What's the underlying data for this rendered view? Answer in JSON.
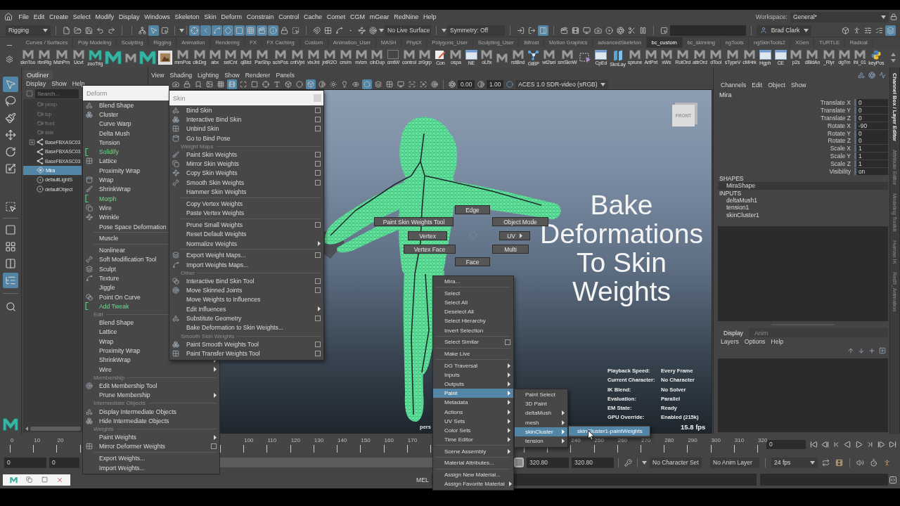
{
  "menu_bar": {
    "items": [
      "File",
      "Edit",
      "Create",
      "Select",
      "Modify",
      "Display",
      "Windows",
      "Skeleton",
      "Skin",
      "Deform",
      "Constrain",
      "Control",
      "Cache",
      "Comet",
      "CGM",
      "mGear",
      "RedNine",
      "Help"
    ],
    "workspace_label": "Workspace:",
    "workspace": "General*"
  },
  "toolbar": {
    "menu_set": "Rigging",
    "select_modes": [
      {
        "selected": false
      },
      {
        "selected": true
      },
      {
        "selected": false
      }
    ],
    "masks": [
      {
        "on": true
      },
      {
        "on": true
      },
      {
        "on": true
      },
      {
        "on": true
      },
      {
        "on": true
      },
      {
        "on": true
      },
      {
        "on": true
      },
      {
        "on": true
      }
    ],
    "live_surface": "No Live Surface",
    "symmetry": "Symmetry: Off",
    "tool_toggles": [
      {
        "selected": false
      },
      {
        "selected": false
      },
      {
        "selected": true
      }
    ],
    "user": "Brad Clark",
    "panel_toggles": [
      {
        "selected": false
      },
      {
        "selected": false
      },
      {
        "selected": false
      },
      {
        "selected": false
      },
      {
        "selected": true
      }
    ]
  },
  "shelf": {
    "tabs": [
      {
        "label": "Curves / Surfaces",
        "selected": false
      },
      {
        "label": "Poly Modeling",
        "selected": false
      },
      {
        "label": "Sculpting",
        "selected": false
      },
      {
        "label": "Rigging",
        "selected": false
      },
      {
        "label": "Animation",
        "selected": false
      },
      {
        "label": "Rendering",
        "selected": false
      },
      {
        "label": "FX",
        "selected": false
      },
      {
        "label": "FX Caching",
        "selected": false
      },
      {
        "label": "Custom",
        "selected": false
      },
      {
        "label": "Animation_User",
        "selected": false
      },
      {
        "label": "MASH",
        "selected": false
      },
      {
        "label": "PhysX",
        "selected": false
      },
      {
        "label": "Polygons_User",
        "selected": false
      },
      {
        "label": "Sculpting_User",
        "selected": false
      },
      {
        "label": "Bifrost",
        "selected": false
      },
      {
        "label": "Motion Graphics",
        "selected": false
      },
      {
        "label": "advancedSkeleton",
        "selected": false
      },
      {
        "label": "bc_custom",
        "selected": true
      },
      {
        "label": "bc_skinning",
        "selected": false
      },
      {
        "label": "ngTools",
        "selected": false
      },
      {
        "label": "ngSkinTools2",
        "selected": false
      },
      {
        "label": "XGen",
        "selected": false
      },
      {
        "label": "TURTLE",
        "selected": false
      },
      {
        "label": "Radical",
        "selected": false
      }
    ],
    "items": [
      {
        "kind": "script",
        "label": "sknToo"
      },
      {
        "kind": "script",
        "label": "rbnRig"
      },
      {
        "kind": "script",
        "label": "MshPrn"
      },
      {
        "kind": "script",
        "label": "Ucvt"
      },
      {
        "kind": "teal",
        "label": "zooTrig"
      },
      {
        "kind": "teal"
      },
      {
        "kind": "script"
      },
      {
        "kind": "teal"
      },
      {
        "kind": "image"
      },
      {
        "kind": "script",
        "label": "mmPos"
      },
      {
        "kind": "script",
        "label": "clkDrg"
      },
      {
        "kind": "script",
        "label": "abx"
      },
      {
        "kind": "script",
        "label": "selCnt"
      },
      {
        "kind": "script",
        "label": "qBlst"
      },
      {
        "kind": "script",
        "label": "ParShp"
      },
      {
        "kind": "script",
        "label": "schPos"
      },
      {
        "kind": "script",
        "label": "cntVjnt"
      },
      {
        "kind": "script",
        "label": "vtxJnt"
      },
      {
        "kind": "script",
        "label": "jntR2O"
      },
      {
        "kind": "script",
        "label": "cm/m"
      },
      {
        "kind": "script",
        "label": "m/cm"
      },
      {
        "kind": "script",
        "label": "clnDup"
      },
      {
        "kind": "blank",
        "label": "cmtW"
      },
      {
        "kind": "script",
        "label": "control"
      },
      {
        "kind": "script",
        "label": "zr0grp"
      },
      {
        "kind": "pencil",
        "label": "Con"
      },
      {
        "kind": "script",
        "label": "ospa"
      },
      {
        "kind": "window",
        "label": "NE"
      },
      {
        "kind": "script",
        "label": "oLfix"
      },
      {
        "kind": "script"
      },
      {
        "kind": "script",
        "label": "rstBnd"
      },
      {
        "kind": "network",
        "label": "GtBP"
      },
      {
        "kind": "script",
        "label": "wt2sel"
      },
      {
        "kind": "script",
        "label": "smSknW"
      },
      {
        "kind": "select"
      },
      {
        "kind": "window",
        "label": "CpEd"
      },
      {
        "kind": "layers",
        "label": "SknLay"
      },
      {
        "kind": "script",
        "label": "sprune"
      },
      {
        "kind": "script",
        "label": "ArtPnt"
      },
      {
        "kind": "script",
        "label": "xWs"
      },
      {
        "kind": "script",
        "label": "RotOrd"
      },
      {
        "kind": "script",
        "label": "attrOrd"
      },
      {
        "kind": "script",
        "label": "dTool"
      },
      {
        "kind": "script",
        "label": "sTypeV"
      },
      {
        "kind": "script",
        "label": "cMHrk"
      },
      {
        "kind": "window",
        "label": "Hgph"
      },
      {
        "kind": "window",
        "label": "CE"
      },
      {
        "kind": "script",
        "label": "p2s"
      },
      {
        "kind": "script",
        "label": "dBldAn"
      },
      {
        "kind": "script",
        "label": "_Rlyr"
      },
      {
        "kind": "script",
        "label": "dgTm"
      },
      {
        "kind": "script",
        "label": "ihl_01"
      },
      {
        "kind": "python",
        "label": "keyPos"
      }
    ]
  },
  "toolbox": {
    "tools": [
      {
        "selected": true
      },
      {
        "selected": false
      },
      {
        "selected": false
      },
      {
        "selected": false
      },
      {
        "selected": false
      },
      {
        "selected": false
      },
      {
        "selected": false
      }
    ],
    "layouts": [
      {
        "selected": false
      },
      {
        "selected": false
      },
      {
        "selected": false
      },
      {
        "selected": true
      }
    ]
  },
  "outliner": {
    "title": "Outliner",
    "menu": [
      "Display",
      "Show",
      "Help"
    ],
    "search": {
      "placeholder": "Search..."
    },
    "items": [
      {
        "kind": "camera",
        "label": "persp",
        "dimmed": true,
        "expander": false,
        "selected": false
      },
      {
        "kind": "camera",
        "label": "top",
        "dimmed": true,
        "expander": false,
        "selected": false
      },
      {
        "kind": "camera",
        "label": "front",
        "dimmed": true,
        "expander": false,
        "selected": false
      },
      {
        "kind": "camera",
        "label": "side",
        "dimmed": true,
        "expander": false,
        "selected": false
      },
      {
        "kind": "joint",
        "label": "BaseFBXASC03",
        "dimmed": false,
        "expander": true,
        "selected": false
      },
      {
        "kind": "joint",
        "label": "BaseFBXASC03",
        "dimmed": false,
        "expander": false,
        "selected": false
      },
      {
        "kind": "joint",
        "label": "BaseFBXASC03",
        "dimmed": false,
        "expander": false,
        "selected": false
      },
      {
        "kind": "mesh",
        "label": "Mira",
        "dimmed": false,
        "expander": false,
        "selected": true
      },
      {
        "kind": "set",
        "label": "defaultLightS",
        "dimmed": false,
        "expander": false,
        "selected": false
      },
      {
        "kind": "set",
        "label": "defaultObject",
        "dimmed": false,
        "expander": false,
        "selected": false
      }
    ]
  },
  "viewport": {
    "menu": [
      "View",
      "Shading",
      "Lighting",
      "Show",
      "Renderer",
      "Panels"
    ],
    "tools": [
      {
        "selected": false
      },
      {
        "selected": false
      },
      {
        "selected": false
      },
      {
        "selected": false
      },
      {
        "selected": false
      },
      {
        "selected": true
      },
      {
        "selected": false
      },
      {
        "selected": false
      },
      {
        "selected": false
      },
      {
        "selected": false
      },
      {
        "selected": false
      },
      {
        "selected": false
      },
      {
        "selected": true
      },
      {
        "selected": false
      },
      {
        "selected": false
      },
      {
        "selected": false
      },
      {
        "selected": false
      },
      {
        "selected": true
      },
      {
        "selected": false
      },
      {
        "selected": false
      },
      {
        "selected": false
      },
      {
        "selected": false
      },
      {
        "selected": false
      },
      {
        "selected": false
      }
    ],
    "exposure": "0.00",
    "gamma": "1.00",
    "color_space": "ACES 1.0 SDR-video (sRGB)",
    "view_cube": "FRONT",
    "camera": "pers",
    "title": "Bake Deformations To Skin Weights",
    "marking_menu": [
      {
        "label": "Edge"
      },
      {
        "label": "Paint Skin Weights Tool"
      },
      {
        "label": "Object Mode"
      },
      {
        "label": "Vertex"
      },
      {
        "label": "UV",
        "submenu": true
      },
      {
        "label": "Vertex Face"
      },
      {
        "label": "Multi"
      },
      {
        "label": "Face"
      }
    ],
    "hud": [
      {
        "label": "Playback Speed:",
        "value": "Every Frame"
      },
      {
        "label": "Current Character:",
        "value": "No Character"
      },
      {
        "label": "IK Blend:",
        "value": "No Solver"
      },
      {
        "label": "Evaluation:",
        "value": "Parallel"
      },
      {
        "label": "EM State:",
        "value": "Ready"
      },
      {
        "label": "GPU Override:",
        "value": "Enabled (215k)"
      }
    ],
    "fps": "15.8 fps"
  },
  "channel_box": {
    "menu": [
      "Channels",
      "Edit",
      "Object",
      "Show"
    ],
    "object": "Mira",
    "attributes": [
      {
        "label": "Translate X",
        "value": "0"
      },
      {
        "label": "Translate Y",
        "value": "0"
      },
      {
        "label": "Translate Z",
        "value": "0"
      },
      {
        "label": "Rotate X",
        "value": "-90"
      },
      {
        "label": "Rotate Y",
        "value": "0"
      },
      {
        "label": "Rotate Z",
        "value": "0"
      },
      {
        "label": "Scale X",
        "value": "1"
      },
      {
        "label": "Scale Y",
        "value": "1"
      },
      {
        "label": "Scale Z",
        "value": "1"
      },
      {
        "label": "Visibility",
        "value": "on"
      }
    ],
    "shapes_heading": "SHAPES",
    "shapes": [
      {
        "label": "MiraShape",
        "selected": true
      }
    ],
    "inputs_heading": "INPUTS",
    "inputs": [
      "deltaMush1",
      "tension1",
      "skinCluster1"
    ]
  },
  "layer_editor": {
    "tabs": [
      {
        "label": "Display",
        "selected": true
      },
      {
        "label": "Anim",
        "selected": false
      }
    ],
    "menu": [
      "Layers",
      "Options",
      "Help"
    ]
  },
  "side_tabs": [
    {
      "label": "Channel Box / Layer Editor",
      "selected": true
    },
    {
      "label": "Attribute Editor",
      "selected": false
    },
    {
      "label": "Modeling Toolkit",
      "selected": false
    },
    {
      "label": "Human IK",
      "selected": false
    },
    {
      "label": "Red9_Animation",
      "selected": false
    }
  ],
  "timeline": {
    "ticks": [
      "0",
      "10",
      "20",
      "100",
      "110",
      "120",
      "130",
      "140",
      "150",
      "160",
      "170",
      "240",
      "250",
      "260",
      "270",
      "280",
      "290",
      "300",
      "310",
      "320"
    ],
    "current_frame": "0"
  },
  "range": {
    "animation_start": "0",
    "playback_start": "0",
    "playback_end": "320.80",
    "animation_end": "320.80",
    "character_set": "No Character Set",
    "anim_layer": "No Anim Layer",
    "fps": "24 fps"
  },
  "command_line": {
    "language": "MEL"
  },
  "deform_menu": {
    "title": "Deform",
    "items": [
      {
        "kind": "tool",
        "label": "Blend Shape"
      },
      {
        "kind": "tool",
        "label": "Cluster"
      },
      {
        "kind": "command",
        "label": "Curve Warp"
      },
      {
        "kind": "command",
        "label": "Delta Mush"
      },
      {
        "kind": "command",
        "label": "Tension"
      },
      {
        "kind": "command",
        "label": "Solidify",
        "new": true
      },
      {
        "kind": "tool",
        "label": "Lattice"
      },
      {
        "kind": "command",
        "label": "Proximity Wrap"
      },
      {
        "kind": "tool",
        "label": "Wrap"
      },
      {
        "kind": "tool",
        "label": "ShrinkWrap"
      },
      {
        "kind": "command",
        "label": "Morph",
        "new": true
      },
      {
        "kind": "tool",
        "label": "Wire"
      },
      {
        "kind": "tool",
        "label": "Wrinkle"
      },
      {
        "kind": "command",
        "label": "Pose Space Deformation"
      },
      {
        "kind": "separator"
      },
      {
        "kind": "command",
        "label": "Muscle"
      },
      {
        "kind": "separator"
      },
      {
        "kind": "command",
        "label": "Nonlinear"
      },
      {
        "kind": "tool",
        "label": "Soft Modification Tool"
      },
      {
        "kind": "tool",
        "label": "Sculpt"
      },
      {
        "kind": "tool",
        "label": "Texture"
      },
      {
        "kind": "command",
        "label": "Jiggle"
      },
      {
        "kind": "tool",
        "label": "Point On Curve"
      },
      {
        "kind": "command",
        "label": "Add Tweak",
        "new": true
      },
      {
        "kind": "section",
        "label": "Edit"
      },
      {
        "kind": "command",
        "label": "Blend Shape"
      },
      {
        "kind": "command",
        "label": "Lattice"
      },
      {
        "kind": "command",
        "label": "Wrap"
      },
      {
        "kind": "command",
        "label": "Proximity Wrap"
      },
      {
        "kind": "command",
        "label": "ShrinkWrap",
        "submenu": true
      },
      {
        "kind": "command",
        "label": "Wire",
        "submenu": true
      },
      {
        "kind": "section",
        "label": "Membership"
      },
      {
        "kind": "tool",
        "label": "Edit Membership Tool"
      },
      {
        "kind": "command",
        "label": "Prune Membership",
        "submenu": true
      },
      {
        "kind": "section",
        "label": "Intermediate Objects"
      },
      {
        "kind": "tool",
        "label": "Display Intermediate Objects"
      },
      {
        "kind": "tool",
        "label": "Hide Intermediate Objects"
      },
      {
        "kind": "section",
        "label": "Weights"
      },
      {
        "kind": "command",
        "label": "Paint Weights",
        "submenu": true
      },
      {
        "kind": "tool",
        "label": "Mirror Deformer Weights",
        "option_box": true
      },
      {
        "kind": "separator"
      },
      {
        "kind": "command",
        "label": "Export Weights..."
      },
      {
        "kind": "command",
        "label": "Import Weights..."
      }
    ]
  },
  "skin_menu": {
    "title": "Skin",
    "items": [
      {
        "kind": "tool",
        "label": "Bind Skin",
        "option_box": true
      },
      {
        "kind": "tool",
        "label": "Interactive Bind Skin",
        "option_box": true
      },
      {
        "kind": "tool",
        "label": "Unbind Skin",
        "option_box": true
      },
      {
        "kind": "tool",
        "label": "Go to Bind Pose"
      },
      {
        "kind": "section",
        "label": "Weight Maps"
      },
      {
        "kind": "tool",
        "label": "Paint Skin Weights",
        "option_box": true
      },
      {
        "kind": "tool",
        "label": "Mirror Skin Weights",
        "option_box": true
      },
      {
        "kind": "tool",
        "label": "Copy Skin Weights",
        "option_box": true
      },
      {
        "kind": "tool",
        "label": "Smooth Skin Weights",
        "option_box": true
      },
      {
        "kind": "command",
        "label": "Hammer Skin Weights"
      },
      {
        "kind": "separator"
      },
      {
        "kind": "command",
        "label": "Copy Vertex Weights"
      },
      {
        "kind": "command",
        "label": "Paste Vertex Weights"
      },
      {
        "kind": "separator"
      },
      {
        "kind": "command",
        "label": "Prune Small Weights",
        "option_box": true
      },
      {
        "kind": "command",
        "label": "Reset Default Weights"
      },
      {
        "kind": "command",
        "label": "Normalize Weights",
        "submenu": true
      },
      {
        "kind": "separator"
      },
      {
        "kind": "tool",
        "label": "Export Weight Maps...",
        "option_box": true
      },
      {
        "kind": "tool",
        "label": "Import Weights Maps..."
      },
      {
        "kind": "section",
        "label": "Other"
      },
      {
        "kind": "tool",
        "label": "Interactive Bind Skin Tool",
        "option_box": true
      },
      {
        "kind": "tool",
        "label": "Move Skinned Joints",
        "option_box": true
      },
      {
        "kind": "command",
        "label": "Move Weights to Influences"
      },
      {
        "kind": "command",
        "label": "Edit Influences",
        "submenu": true
      },
      {
        "kind": "tool",
        "label": "Substitute Geometry",
        "option_box": true
      },
      {
        "kind": "command",
        "label": "Bake Deformation to Skin Weights..."
      },
      {
        "kind": "section",
        "label": "Smooth Skin Weights"
      },
      {
        "kind": "tool",
        "label": "Paint Smooth Weights Tool",
        "option_box": true
      },
      {
        "kind": "tool",
        "label": "Paint Transfer Weights Tool",
        "option_box": true
      }
    ]
  },
  "context_menu": {
    "items": [
      {
        "kind": "command",
        "label": "Mira...",
        "selected": false
      },
      {
        "kind": "separator"
      },
      {
        "kind": "command",
        "label": "Select",
        "selected": false
      },
      {
        "kind": "command",
        "label": "Select All",
        "selected": false
      },
      {
        "kind": "command",
        "label": "Deselect All",
        "selected": false
      },
      {
        "kind": "command",
        "label": "Select Hierarchy",
        "selected": false
      },
      {
        "kind": "command",
        "label": "Invert Selection",
        "selected": false
      },
      {
        "kind": "separator"
      },
      {
        "kind": "command",
        "label": "Select Similar",
        "option_box": true,
        "selected": false
      },
      {
        "kind": "separator"
      },
      {
        "kind": "command",
        "label": "Make Live",
        "selected": false
      },
      {
        "kind": "separator"
      },
      {
        "kind": "command",
        "label": "DG Traversal",
        "submenu": true,
        "selected": false
      },
      {
        "kind": "command",
        "label": "Inputs",
        "submenu": true,
        "selected": false
      },
      {
        "kind": "command",
        "label": "Outputs",
        "submenu": true,
        "selected": false
      },
      {
        "kind": "command",
        "label": "Paint",
        "submenu": true,
        "selected": true
      },
      {
        "kind": "command",
        "label": "Metadata",
        "submenu": true,
        "selected": false
      },
      {
        "kind": "command",
        "label": "Actions",
        "submenu": true,
        "selected": false
      },
      {
        "kind": "command",
        "label": "UV Sets",
        "submenu": true,
        "selected": false
      },
      {
        "kind": "command",
        "label": "Color Sets",
        "submenu": true,
        "selected": false
      },
      {
        "kind": "command",
        "label": "Time Editor",
        "submenu": true,
        "selected": false
      },
      {
        "kind": "separator"
      },
      {
        "kind": "command",
        "label": "Scene Assembly",
        "submenu": true,
        "selected": false
      },
      {
        "kind": "separator"
      },
      {
        "kind": "command",
        "label": "Material Attributes...",
        "selected": false
      },
      {
        "kind": "separator"
      },
      {
        "kind": "command",
        "label": "Assign New Material...",
        "selected": false
      },
      {
        "kind": "command",
        "label": "Assign Favorite Material",
        "submenu": true,
        "selected": false
      }
    ]
  },
  "paint_submenu": {
    "items": [
      {
        "kind": "command",
        "label": "Paint Select",
        "selected": false
      },
      {
        "kind": "command",
        "label": "3D Paint",
        "selected": false
      },
      {
        "kind": "command",
        "label": "deltaMush",
        "submenu": true,
        "selected": false
      },
      {
        "kind": "command",
        "label": "mesh",
        "submenu": true,
        "selected": false
      },
      {
        "kind": "command",
        "label": "skinCluster",
        "submenu": true,
        "selected": true
      },
      {
        "kind": "command",
        "label": "tension",
        "submenu": true,
        "selected": false
      }
    ]
  },
  "skincluster_submenu": {
    "items": [
      {
        "kind": "command",
        "label": "skinCluster1-paintWeights",
        "selected": true
      }
    ]
  }
}
